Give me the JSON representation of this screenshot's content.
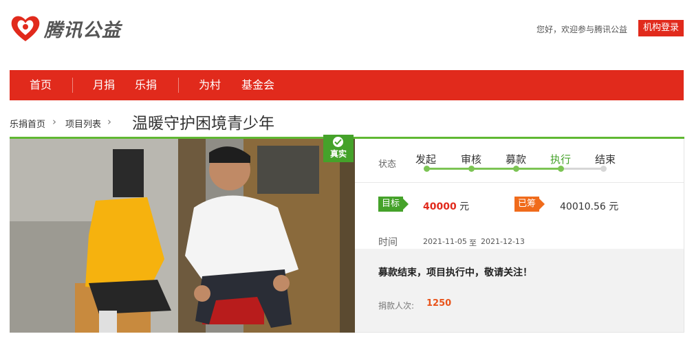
{
  "header": {
    "logo_text": "腾讯公益",
    "greeting": "您好，欢迎参与腾讯公益",
    "login_button": "机构登录"
  },
  "nav": {
    "items": [
      "首页",
      "月捐",
      "乐捐",
      "为村",
      "基金会"
    ]
  },
  "breadcrumb": {
    "items": [
      "乐捐首页",
      "项目列表"
    ]
  },
  "project": {
    "title": "温暖守护困境青少年",
    "verified_badge": "真实",
    "status_label": "状态",
    "steps": [
      {
        "label": "发起",
        "done": true
      },
      {
        "label": "审核",
        "done": true
      },
      {
        "label": "募款",
        "done": true
      },
      {
        "label": "执行",
        "done": true,
        "current": true
      },
      {
        "label": "结束",
        "done": false
      }
    ],
    "goal_label": "目标",
    "goal_amount": "40000",
    "currency": "元",
    "raised_label": "已筹",
    "raised_amount": "40010.56 元",
    "time_label": "时间",
    "start_date": "2021-11-05",
    "date_separator": "至",
    "end_date": "2021-12-13",
    "notice": "募款结束，项目执行中，敬请关注！",
    "donors_label": "捐款人次:",
    "donors_count": "1250"
  },
  "colors": {
    "brand_red": "#e12a1c",
    "green": "#45a22a",
    "orange": "#f06b1b"
  }
}
